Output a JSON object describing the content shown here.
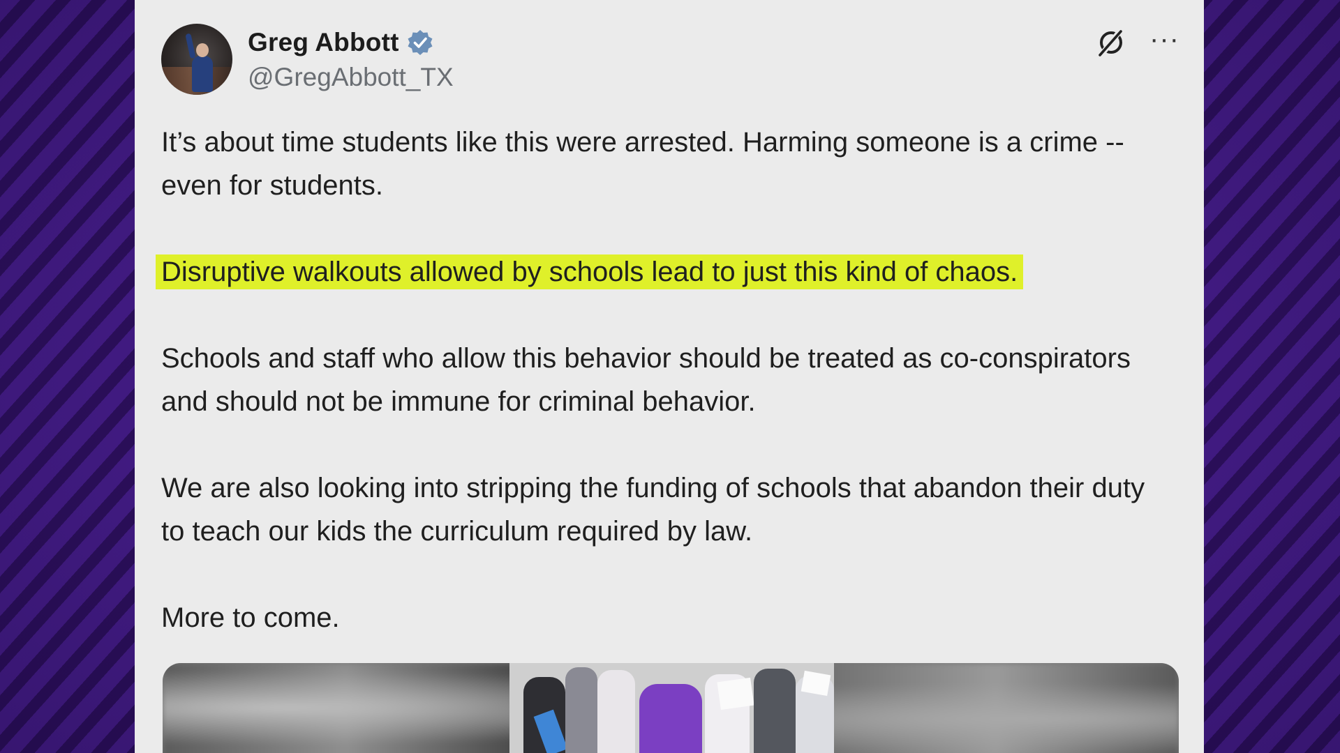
{
  "tweet": {
    "display_name": "Greg Abbott",
    "handle": "@GregAbbott_TX",
    "verified": true,
    "verified_badge_color": "#6b8fb8",
    "highlight_color": "#dff02a",
    "paragraphs": [
      "It’s about time students like this were arrested. Harming someone is a crime -- even for students.",
      "Disruptive walkouts allowed by schools lead to just this kind of chaos.",
      "Schools and staff who allow this behavior should be treated as co-conspirators and should not be immune for criminal behavior.",
      "We are also looking into stripping the funding of schools that abandon their duty to teach our kids the curriculum required by law.",
      "More to come."
    ]
  },
  "icons": {
    "grok": "grok-icon",
    "more": "more-options-icon",
    "verified": "verified-badge-icon"
  }
}
